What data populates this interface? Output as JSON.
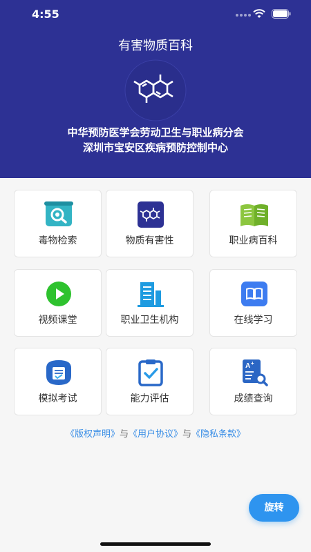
{
  "status_bar": {
    "time": "4:55"
  },
  "header": {
    "title": "有害物质百科",
    "org_line_1": "中华预防医学会劳动卫生与职业病分会",
    "org_line_2": "深圳市宝安区疾病预防控制中心"
  },
  "menu": [
    {
      "label": "毒物检索",
      "icon": "poison-search-icon"
    },
    {
      "label": "物质有害性",
      "icon": "molecule-icon"
    },
    {
      "label": "职业病百科",
      "icon": "open-book-icon"
    },
    {
      "label": "视频课堂",
      "icon": "play-video-icon"
    },
    {
      "label": "职业卫生机构",
      "icon": "building-icon"
    },
    {
      "label": "在线学习",
      "icon": "book-icon"
    },
    {
      "label": "模拟考试",
      "icon": "exam-icon"
    },
    {
      "label": "能力评估",
      "icon": "clipboard-check-icon"
    },
    {
      "label": "成绩查询",
      "icon": "score-search-icon"
    }
  ],
  "links": {
    "copyright": "《版权声明》",
    "sep1": "与",
    "user_agreement": "《用户协议》",
    "sep2": "与",
    "privacy": "《隐私条款》"
  },
  "rotate_button": "旋转",
  "colors": {
    "header_bg": "#2d3194",
    "accent_blue": "#2e94ef",
    "link": "#3a8ee6"
  }
}
